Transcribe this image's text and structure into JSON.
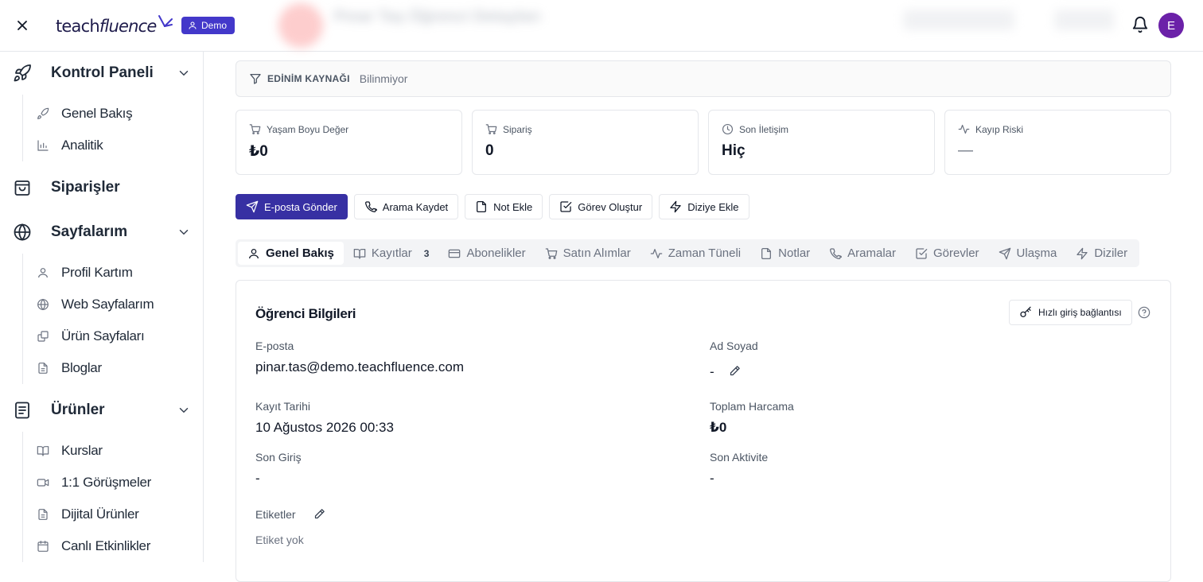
{
  "brand": {
    "logo_text_1": "teach",
    "logo_text_2": "fluence",
    "demo_badge": "Demo",
    "accent": "#3730a3"
  },
  "header": {
    "blurred_title": "Pınar Taş Öğrenci Detayları",
    "avatar_initial": "E"
  },
  "sidebar": {
    "sections": [
      {
        "label": "Kontrol Paneli",
        "icon": "rocket-icon",
        "expandable": true,
        "items": [
          {
            "label": "Genel Bakış",
            "icon": "rocket-icon"
          },
          {
            "label": "Analitik",
            "icon": "bar-chart-icon"
          }
        ]
      },
      {
        "label": "Siparişler",
        "icon": "shopping-bag-icon",
        "expandable": false,
        "items": []
      },
      {
        "label": "Sayfalarım",
        "icon": "globe-icon",
        "expandable": true,
        "items": [
          {
            "label": "Profil Kartım",
            "icon": "user-icon"
          },
          {
            "label": "Web Sayfalarım",
            "icon": "globe-icon"
          },
          {
            "label": "Ürün Sayfaları",
            "icon": "link-icon"
          },
          {
            "label": "Bloglar",
            "icon": "file-text-icon"
          }
        ]
      },
      {
        "label": "Ürünler",
        "icon": "document-icon",
        "expandable": true,
        "items": [
          {
            "label": "Kurslar",
            "icon": "book-open-icon"
          },
          {
            "label": "1:1 Görüşmeler",
            "icon": "video-icon"
          },
          {
            "label": "Dijital Ürünler",
            "icon": "file-text-icon"
          },
          {
            "label": "Canlı Etkinlikler",
            "icon": "calendar-icon"
          }
        ]
      }
    ]
  },
  "source": {
    "label": "EDİNİM KAYNAĞI",
    "value": "Bilinmiyor"
  },
  "stats": [
    {
      "label": "Yaşam Boyu Değer",
      "value": "₺0",
      "icon": "cart-icon"
    },
    {
      "label": "Sipariş",
      "value": "0",
      "icon": "cart-icon"
    },
    {
      "label": "Son İletişim",
      "value": "Hiç",
      "icon": "clock-icon"
    },
    {
      "label": "Kayıp Riski",
      "value": "—",
      "icon": "activity-icon"
    }
  ],
  "actions": [
    {
      "label": "E-posta Gönder",
      "icon": "send-icon"
    },
    {
      "label": "Arama Kaydet",
      "icon": "phone-icon"
    },
    {
      "label": "Not Ekle",
      "icon": "note-icon"
    },
    {
      "label": "Görev Oluştur",
      "icon": "check-square-icon"
    },
    {
      "label": "Diziye Ekle",
      "icon": "zap-icon"
    }
  ],
  "tabs": [
    {
      "label": "Genel Bakış",
      "icon": "user-icon"
    },
    {
      "label": "Kayıtlar",
      "icon": "book-open-icon",
      "count": "3"
    },
    {
      "label": "Abonelikler",
      "icon": "credit-card-icon"
    },
    {
      "label": "Satın Alımlar",
      "icon": "cart-icon"
    },
    {
      "label": "Zaman Tüneli",
      "icon": "activity-icon"
    },
    {
      "label": "Notlar",
      "icon": "note-icon"
    },
    {
      "label": "Aramalar",
      "icon": "phone-icon"
    },
    {
      "label": "Görevler",
      "icon": "check-square-icon"
    },
    {
      "label": "Ulaşma",
      "icon": "send-icon"
    },
    {
      "label": "Diziler",
      "icon": "zap-icon"
    }
  ],
  "info": {
    "title": "Öğrenci Bilgileri",
    "quick_link_label": "Hızlı giriş bağlantısı",
    "fields": {
      "email_label": "E-posta",
      "email_value": "pinar.tas@demo.teachfluence.com",
      "name_label": "Ad Soyad",
      "name_value": "-",
      "reg_label": "Kayıt Tarihi",
      "reg_value": "10 Ağustos 2026 00:33",
      "spend_label": "Toplam Harcama",
      "spend_value": "₺0",
      "login_label": "Son Giriş",
      "login_value": "-",
      "activity_label": "Son Aktivite",
      "activity_value": "-",
      "tags_label": "Etiketler",
      "tags_value": "Etiket yok"
    }
  }
}
